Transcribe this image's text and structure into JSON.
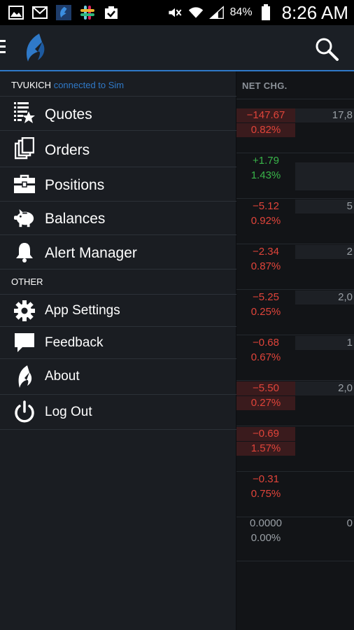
{
  "status_bar": {
    "battery": "84%",
    "time": "8:26 AM"
  },
  "drawer": {
    "username": "TVUKICH",
    "connection_status": "connected to Sim",
    "main_items": [
      {
        "label": "Quotes",
        "icon": "quotes-star-list-icon"
      },
      {
        "label": "Orders",
        "icon": "orders-documents-icon"
      },
      {
        "label": "Positions",
        "icon": "briefcase-icon"
      },
      {
        "label": "Balances",
        "icon": "piggy-bank-icon"
      },
      {
        "label": "Alert Manager",
        "icon": "bell-icon"
      }
    ],
    "section_other": "OTHER",
    "other_items": [
      {
        "label": "App Settings",
        "icon": "gear-icon"
      },
      {
        "label": "Feedback",
        "icon": "speech-bubble-icon"
      },
      {
        "label": "About",
        "icon": "app-logo-icon"
      },
      {
        "label": "Log Out",
        "icon": "power-icon"
      }
    ]
  },
  "table": {
    "header": "NET CHG.",
    "rows": [
      {
        "chg": "−147.67",
        "pct": "0.82%",
        "trend": "down",
        "highlight": true,
        "extra": "17,8"
      },
      {
        "chg": "+1.79",
        "pct": "1.43%",
        "trend": "up",
        "highlight": false,
        "extra": ""
      },
      {
        "chg": "−5.12",
        "pct": "0.92%",
        "trend": "down",
        "highlight": false,
        "extra": "5"
      },
      {
        "chg": "−2.34",
        "pct": "0.87%",
        "trend": "down",
        "highlight": false,
        "extra": "2"
      },
      {
        "chg": "−5.25",
        "pct": "0.25%",
        "trend": "down",
        "highlight": false,
        "extra": "2,0"
      },
      {
        "chg": "−0.68",
        "pct": "0.67%",
        "trend": "down",
        "highlight": false,
        "extra": "1"
      },
      {
        "chg": "−5.50",
        "pct": "0.27%",
        "trend": "down",
        "highlight": true,
        "extra": "2,0"
      },
      {
        "chg": "−0.69",
        "pct": "1.57%",
        "trend": "down",
        "highlight": true,
        "extra": ""
      },
      {
        "chg": "−0.31",
        "pct": "0.75%",
        "trend": "down",
        "highlight": false,
        "extra": ""
      },
      {
        "chg": "0.0000",
        "pct": "0.00%",
        "trend": "flat",
        "highlight": false,
        "extra": "0"
      }
    ]
  },
  "colors": {
    "accent": "#2f79c8",
    "down": "#e0443a",
    "up": "#39b54a"
  }
}
